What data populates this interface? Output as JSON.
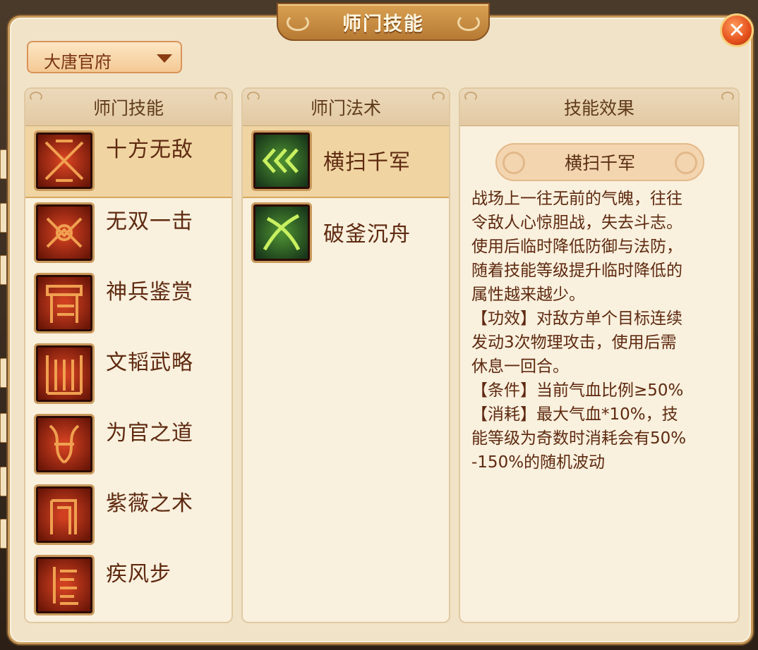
{
  "window": {
    "title": "师门技能"
  },
  "dropdown": {
    "selected": "大唐官府"
  },
  "columns": {
    "skills": {
      "header": "师门技能",
      "items": [
        {
          "label": "十方无敌",
          "icon": "crossed-blades-icon"
        },
        {
          "label": "无双一击",
          "icon": "twin-strike-icon"
        },
        {
          "label": "神兵鉴赏",
          "icon": "weapon-rack-icon"
        },
        {
          "label": "文韬武略",
          "icon": "scroll-gate-icon"
        },
        {
          "label": "为官之道",
          "icon": "vine-crest-icon"
        },
        {
          "label": "紫薇之术",
          "icon": "pillar-icon"
        },
        {
          "label": "疾风步",
          "icon": "wind-step-icon"
        }
      ]
    },
    "spells": {
      "header": "师门法术",
      "items": [
        {
          "label": "横扫千军",
          "icon": "sweep-arrows-icon"
        },
        {
          "label": "破釜沉舟",
          "icon": "crossed-sabers-icon"
        }
      ]
    },
    "effect": {
      "header": "技能效果",
      "title": "横扫千军",
      "lines": [
        "战场上一往无前的气魄，往往",
        "令敌人心惊胆战，失去斗志。",
        "使用后临时降低防御与法防，",
        "随着技能等级提升临时降低的",
        "属性越来越少。",
        "【功效】对敌方单个目标连续",
        "发动3次物理攻击，使用后需",
        "休息一回合。",
        "【条件】当前气血比例≥50%",
        "【消耗】最大气血*10%，技",
        "能等级为奇数时消耗会有50%",
        "-150%的随机波动"
      ]
    }
  },
  "close": {
    "icon": "close-icon",
    "glyph": "✕"
  },
  "colors": {
    "panel": "#f1e3c8",
    "accent": "#b77a34",
    "text": "#5e2a10",
    "selected": "#f0d5a2"
  }
}
